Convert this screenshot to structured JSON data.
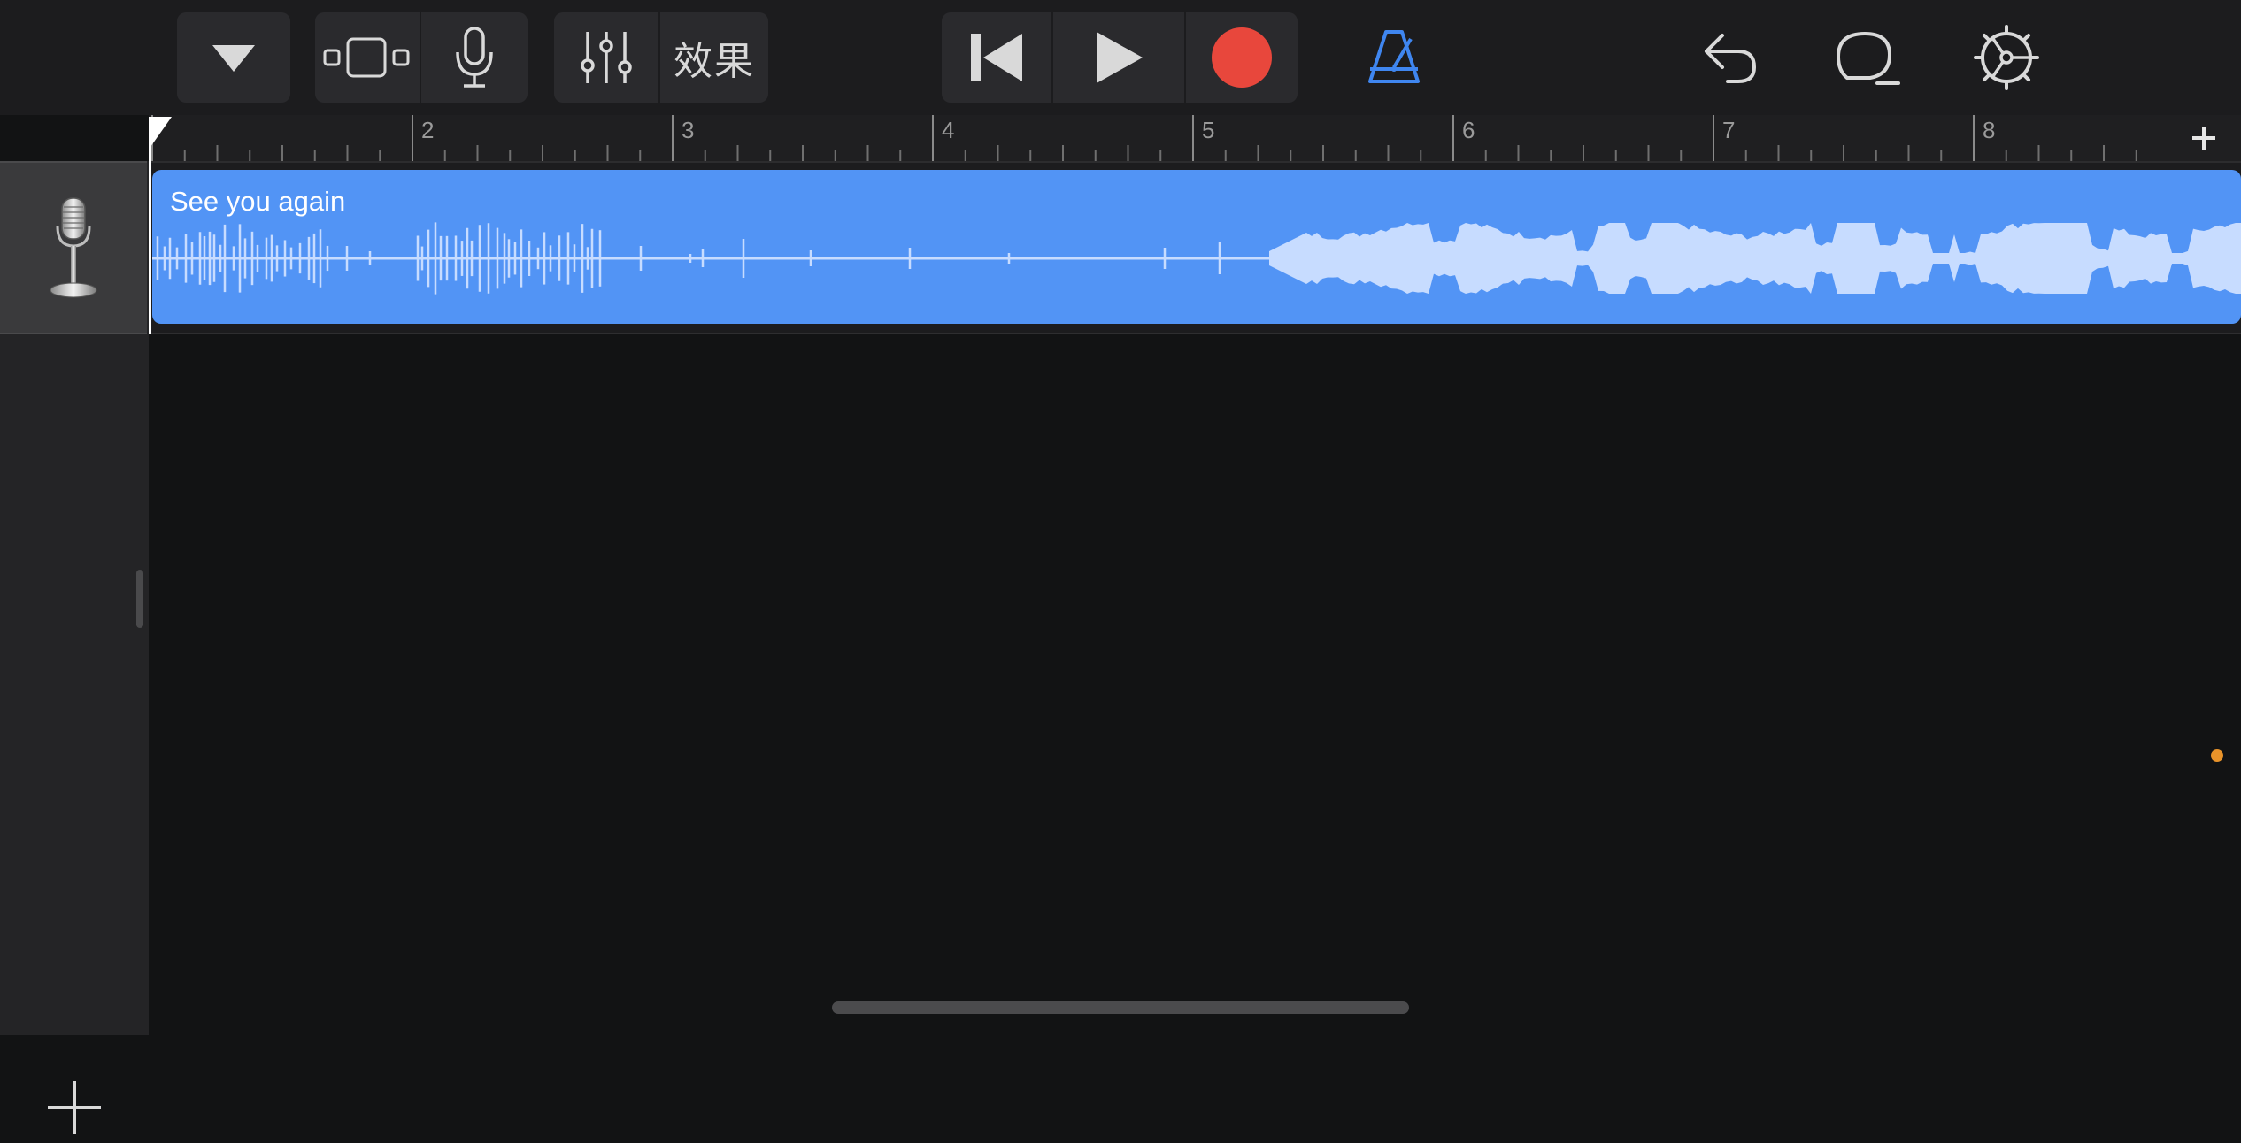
{
  "toolbar": {
    "browser_icon": "triangle-down-icon",
    "track_view_icon": "tracks-view-icon",
    "instrument_icon": "microphone-icon",
    "mixer_icon": "sliders-icon",
    "fx_label": "效果",
    "rewind_icon": "skip-back-icon",
    "play_icon": "play-icon",
    "record_icon": "record-icon",
    "metronome_icon": "metronome-icon",
    "undo_icon": "undo-icon",
    "loop_icon": "loop-browser-icon",
    "settings_icon": "gear-icon"
  },
  "ruler": {
    "bars": [
      "2",
      "3",
      "4",
      "5",
      "6",
      "7",
      "8"
    ],
    "add_section_icon": "plus-icon"
  },
  "tracks": [
    {
      "instrument_icon": "microphone-icon",
      "region_name": "See you again"
    }
  ],
  "add_track_icon": "plus-icon",
  "colors": {
    "region": "#5294f5",
    "waveform": "#c7dcff",
    "record": "#e8473c",
    "metronome": "#3f86f0",
    "background": "#121314"
  }
}
